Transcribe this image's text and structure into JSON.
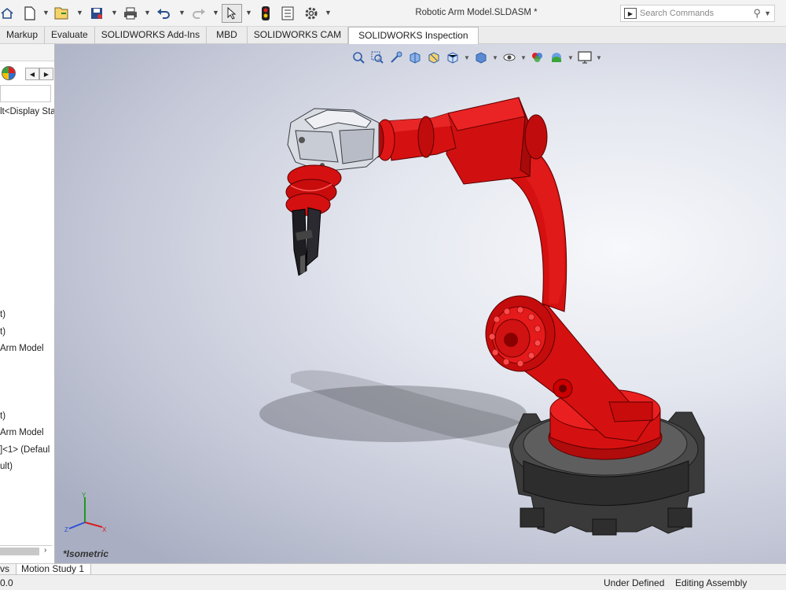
{
  "window": {
    "title": "Robotic Arm Model.SLDASM *"
  },
  "toolbar": {
    "icons": [
      "home-icon",
      "new-document-icon",
      "open-icon",
      "save-icon",
      "print-icon",
      "undo-icon",
      "redo-icon",
      "select-cursor-icon",
      "rebuild-icon",
      "file-properties-icon",
      "options-gear-icon"
    ]
  },
  "search": {
    "placeholder": "Search Commands"
  },
  "tabs": [
    {
      "label": "Markup"
    },
    {
      "label": "Evaluate"
    },
    {
      "label": "SOLIDWORKS Add-Ins"
    },
    {
      "label": "MBD"
    },
    {
      "label": "SOLIDWORKS CAM"
    },
    {
      "label": "SOLIDWORKS Inspection",
      "active": true
    }
  ],
  "feature_tree": {
    "items": [
      "lt<Display Sta",
      "t)",
      "t)",
      "Arm Model",
      "t)",
      "Arm Model",
      "]<1> (Defaul",
      "ult)"
    ]
  },
  "viewport": {
    "view_label": "*Isometric",
    "model_colors": {
      "arm": "#e01010",
      "gripper_housing": "#d9dce2",
      "base": "#3a3a3a"
    }
  },
  "bottom_tabs": [
    {
      "label": "vs"
    },
    {
      "label": "Motion Study 1",
      "active": true
    }
  ],
  "status": {
    "left": "0.0",
    "definition": "Under Defined",
    "mode": "Editing Assembly"
  }
}
